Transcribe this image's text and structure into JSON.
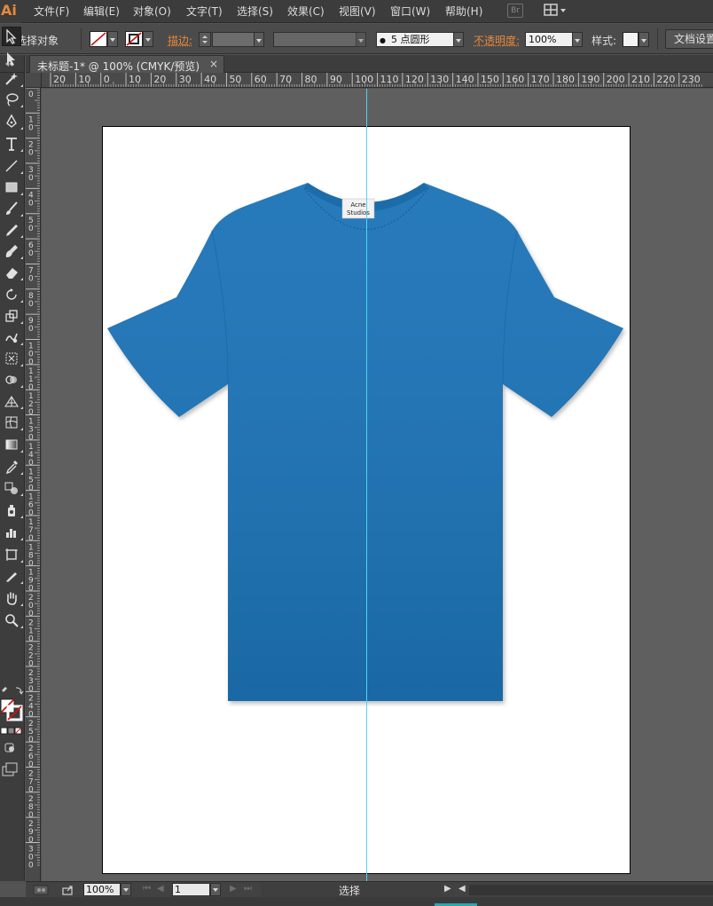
{
  "app": {
    "logo": "Ai"
  },
  "menu": [
    "文件(F)",
    "编辑(E)",
    "对象(O)",
    "文字(T)",
    "选择(S)",
    "效果(C)",
    "视图(V)",
    "窗口(W)",
    "帮助(H)"
  ],
  "menubar": {
    "bridge_label": "Br",
    "workspace_icon": "workspace-layout-icon"
  },
  "control": {
    "selection_status": "未选择对象",
    "stroke_label": "描边:",
    "brush_dot": "●",
    "brush_label": "5 点圆形",
    "opacity_label": "不透明度:",
    "opacity_value": "100%",
    "style_label": "样式:",
    "doc_settings": "文档设置",
    "fill_color": "none",
    "stroke_color": "none"
  },
  "document": {
    "tab_title": "未标题-1* @ 100% (CMYK/预览)",
    "close_glyph": "×",
    "guide_color": "#4fd4f0"
  },
  "rulers": {
    "horizontal_labels": [
      "20",
      "10",
      "0",
      "10",
      "20",
      "30",
      "40",
      "50",
      "60",
      "70",
      "80",
      "90",
      "100",
      "110",
      "120",
      "130",
      "140",
      "150",
      "160",
      "170",
      "180",
      "190",
      "200",
      "210",
      "220",
      "230"
    ],
    "vertical_labels": [
      "0",
      "10",
      "20",
      "30",
      "40",
      "50",
      "60",
      "70",
      "80",
      "90",
      "100",
      "110",
      "120",
      "130",
      "140",
      "150",
      "160",
      "170",
      "180",
      "190",
      "200",
      "210",
      "220",
      "230",
      "240",
      "250",
      "260",
      "270",
      "280",
      "290",
      "300"
    ]
  },
  "artwork": {
    "shirt_color": "#1f73b7",
    "label_line1": "Acne",
    "label_line2": "Studios"
  },
  "tools": [
    "selection-tool-icon",
    "direct-selection-tool-icon",
    "magic-wand-tool-icon",
    "lasso-tool-icon",
    "pen-tool-icon",
    "type-tool-icon",
    "line-segment-tool-icon",
    "rectangle-tool-icon",
    "paintbrush-tool-icon",
    "pencil-tool-icon",
    "blob-brush-tool-icon",
    "eraser-tool-icon",
    "rotate-tool-icon",
    "scale-tool-icon",
    "warp-tool-icon",
    "free-transform-tool-icon",
    "shape-builder-tool-icon",
    "perspective-grid-tool-icon",
    "mesh-tool-icon",
    "gradient-tool-icon",
    "eyedropper-tool-icon",
    "blend-tool-icon",
    "symbol-sprayer-tool-icon",
    "column-graph-tool-icon",
    "artboard-tool-icon",
    "slice-tool-icon",
    "hand-tool-icon",
    "zoom-tool-icon"
  ],
  "status": {
    "zoom": "100%",
    "artboard_number": "1",
    "tool_name": "选择"
  }
}
